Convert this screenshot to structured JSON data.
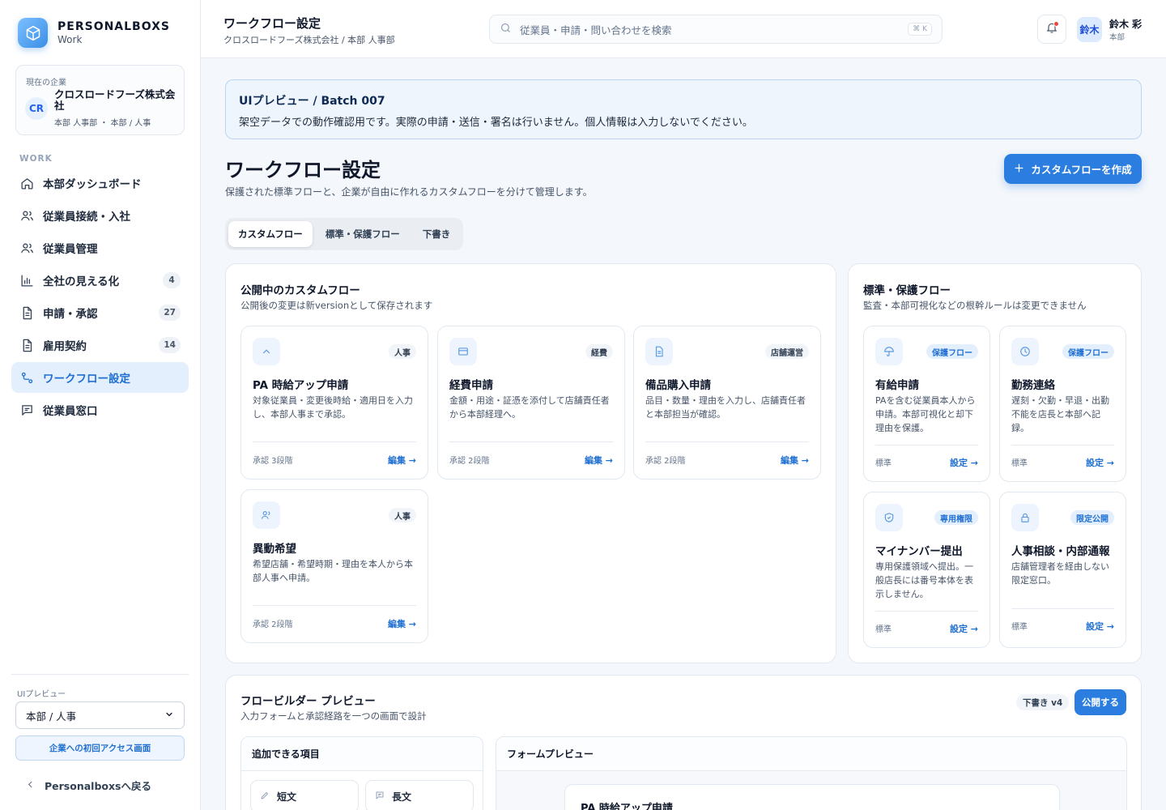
{
  "brand": {
    "name": "PERSONALBOXS",
    "sub": "Work"
  },
  "company": {
    "caption": "現在の企業",
    "avatar": "CR",
    "name": "クロスロードフーズ株式会社",
    "dept": "本部 人事部 ・ 本部 / 人事"
  },
  "nav": {
    "section": "WORK",
    "items": [
      {
        "label": "本部ダッシュボード",
        "icon": "home-icon"
      },
      {
        "label": "従業員接続・入社",
        "icon": "users-icon"
      },
      {
        "label": "従業員管理",
        "icon": "users-icon"
      },
      {
        "label": "全社の見える化",
        "icon": "bar-chart-icon",
        "badge": "4"
      },
      {
        "label": "申請・承認",
        "icon": "document-icon",
        "badge": "27"
      },
      {
        "label": "雇用契約",
        "icon": "document-icon",
        "badge": "14"
      },
      {
        "label": "ワークフロー設定",
        "icon": "workflow-icon",
        "active": true
      },
      {
        "label": "従業員窓口",
        "icon": "message-icon"
      }
    ]
  },
  "sidebar_footer": {
    "preview_label": "UIプレビュー",
    "preview_select": "本部 / 人事",
    "first_access": "企業への初回アクセス画面",
    "back": "Personalboxsへ戻る"
  },
  "topbar": {
    "title": "ワークフロー設定",
    "breadcrumb": "クロスロードフーズ株式会社 / 本部 人事部",
    "search_placeholder": "従業員・申請・問い合わせを検索",
    "search_shortcut": "⌘ K",
    "user_avatar": "鈴木",
    "user_name": "鈴木 彩",
    "user_role": "本部"
  },
  "notice": {
    "title": "UIプレビュー / Batch 007",
    "text": "架空データでの動作確認用です。実際の申請・送信・署名は行いません。個人情報は入力しないでください。"
  },
  "page": {
    "title": "ワークフロー設定",
    "subtitle": "保護された標準フローと、企業が自由に作れるカスタムフローを分けて管理します。",
    "create_button": "カスタムフローを作成"
  },
  "tabs": [
    "カスタムフロー",
    "標準・保護フロー",
    "下書き"
  ],
  "custom_panel": {
    "title": "公開中のカスタムフロー",
    "subtitle": "公開後の変更は新versionとして保存されます",
    "cards": [
      {
        "tag": "人事",
        "title": "PA 時給アップ申請",
        "desc": "対象従業員・変更後時給・適用日を入力し、本部人事まで承認。",
        "meta": "承認 3段階",
        "link": "編集 →",
        "icon": "chevron-up-icon"
      },
      {
        "tag": "経費",
        "title": "経費申請",
        "desc": "金額・用途・証憑を添付して店舗責任者から本部経理へ。",
        "meta": "承認 2段階",
        "link": "編集 →",
        "icon": "wallet-icon"
      },
      {
        "tag": "店舗運営",
        "title": "備品購入申請",
        "desc": "品目・数量・理由を入力し、店舗責任者と本部担当が確認。",
        "meta": "承認 2段階",
        "link": "編集 →",
        "icon": "document-icon"
      },
      {
        "tag": "人事",
        "title": "異動希望",
        "desc": "希望店舗・希望時期・理由を本人から本部人事へ申請。",
        "meta": "承認 2段階",
        "link": "編集 →",
        "icon": "users-icon"
      }
    ]
  },
  "standard_panel": {
    "title": "標準・保護フロー",
    "subtitle": "監査・本部可視化などの根幹ルールは変更できません",
    "cards": [
      {
        "tag": "保護フロー",
        "title": "有給申請",
        "desc": "PAを含む従業員本人から申請。本部可視化と却下理由を保護。",
        "meta": "標準",
        "link": "設定 →",
        "icon": "umbrella-icon"
      },
      {
        "tag": "保護フロー",
        "title": "勤務連絡",
        "desc": "遅刻・欠勤・早退・出勤不能を店長と本部へ記録。",
        "meta": "標準",
        "link": "設定 →",
        "icon": "clock-icon"
      },
      {
        "tag": "専用権限",
        "title": "マイナンバー提出",
        "desc": "専用保護領域へ提出。一般店長には番号本体を表示しません。",
        "meta": "標準",
        "link": "設定 →",
        "icon": "shield-icon"
      },
      {
        "tag": "限定公開",
        "title": "人事相談・内部通報",
        "desc": "店舗管理者を経由しない限定窓口。",
        "meta": "標準",
        "link": "設定 →",
        "icon": "lock-icon"
      }
    ]
  },
  "builder": {
    "title": "フロービルダー プレビュー",
    "subtitle": "入力フォームと承認経路を一つの画面で設計",
    "draft_badge": "下書き v4",
    "publish_button": "公開する",
    "items_title": "追加できる項目",
    "items": [
      "短文",
      "長文"
    ],
    "form_title": "フォームプレビュー",
    "form_card_title": "PA 時給アップ申請"
  }
}
